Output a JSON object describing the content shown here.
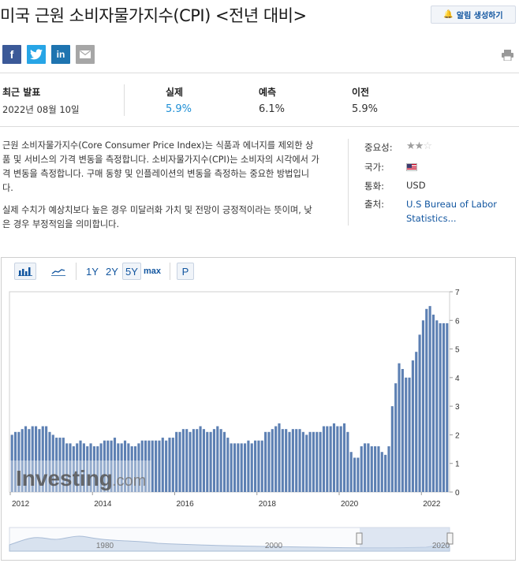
{
  "page": {
    "title": "미국 근원 소비자물가지수(CPI) <전년 대비>",
    "alert_button": "알림 생성하기"
  },
  "social": {
    "facebook": "f",
    "twitter": "twitter-bird-icon",
    "linkedin": "in",
    "email": "envelope-icon"
  },
  "stats": {
    "latest_label": "최근 발표",
    "latest_date": "2022년 08월 10일",
    "actual_label": "실제",
    "actual_value": "5.9%",
    "forecast_label": "예측",
    "forecast_value": "6.1%",
    "previous_label": "이전",
    "previous_value": "5.9%",
    "actual_color": "#1e8fd5"
  },
  "description": {
    "p1": "근원 소비자물가지수(Core Consumer Price Index)는 식품과 에너지를 제외한 상품 및 서비스의 가격 변동을 측정합니다. 소비자물가지수(CPI)는 소비자의 시각에서 가격 변동을 측정합니다. 구매 동향 및 인플레이션의 변동을 측정하는 중요한 방법입니다.",
    "p2": "실제 수치가 예상치보다 높은 경우 미달러화 가치 및 전망이 긍정적이라는 뜻이며, 낮은 경우 부정적임을 의미합니다."
  },
  "meta": {
    "importance_label": "중요성:",
    "importance_stars": 2,
    "importance_max": 3,
    "country_label": "국가:",
    "country_flag": "us-flag-icon",
    "currency_label": "통화:",
    "currency_value": "USD",
    "source_label": "출처:",
    "source_value": "U.S Bureau of Labor Statistics..."
  },
  "toolbar": {
    "bar_chart": "bar-chart-icon",
    "line_chart": "line-chart-icon",
    "r1y": "1Y",
    "r2y": "2Y",
    "r5y": "5Y",
    "rmax": "max",
    "selected": "5Y",
    "p": "P"
  },
  "chart_data": {
    "type": "bar",
    "watermark": "Investing.com",
    "bar_color": "#5d80b3",
    "x_ticks": [
      "2012",
      "2014",
      "2016",
      "2018",
      "2020",
      "2022"
    ],
    "y_ticks": [
      "0",
      "1",
      "2",
      "3",
      "4",
      "5",
      "6",
      "7"
    ],
    "ylim": [
      0,
      7
    ],
    "x_start_year": 2012,
    "values": [
      2.0,
      2.1,
      2.1,
      2.2,
      2.3,
      2.2,
      2.3,
      2.3,
      2.2,
      2.3,
      2.3,
      2.1,
      2.0,
      1.9,
      1.9,
      1.9,
      1.7,
      1.7,
      1.6,
      1.7,
      1.8,
      1.7,
      1.6,
      1.7,
      1.6,
      1.6,
      1.7,
      1.8,
      1.8,
      1.8,
      1.9,
      1.7,
      1.7,
      1.8,
      1.7,
      1.6,
      1.6,
      1.7,
      1.8,
      1.8,
      1.8,
      1.8,
      1.8,
      1.8,
      1.9,
      1.8,
      1.9,
      1.9,
      2.1,
      2.1,
      2.2,
      2.2,
      2.1,
      2.2,
      2.2,
      2.3,
      2.2,
      2.1,
      2.1,
      2.2,
      2.3,
      2.2,
      2.1,
      1.9,
      1.7,
      1.7,
      1.7,
      1.7,
      1.7,
      1.8,
      1.7,
      1.8,
      1.8,
      1.8,
      2.1,
      2.1,
      2.2,
      2.3,
      2.4,
      2.2,
      2.2,
      2.1,
      2.2,
      2.2,
      2.2,
      2.1,
      2.0,
      2.1,
      2.1,
      2.1,
      2.1,
      2.3,
      2.3,
      2.3,
      2.4,
      2.3,
      2.3,
      2.4,
      2.1,
      1.4,
      1.2,
      1.2,
      1.6,
      1.7,
      1.7,
      1.6,
      1.6,
      1.6,
      1.4,
      1.3,
      1.6,
      3.0,
      3.8,
      4.5,
      4.3,
      4.0,
      4.0,
      4.6,
      4.9,
      5.5,
      6.0,
      6.4,
      6.5,
      6.2,
      6.0,
      5.9,
      5.9,
      5.9
    ],
    "navigator": {
      "x_ticks": [
        "1980",
        "2000",
        "2020"
      ]
    }
  }
}
